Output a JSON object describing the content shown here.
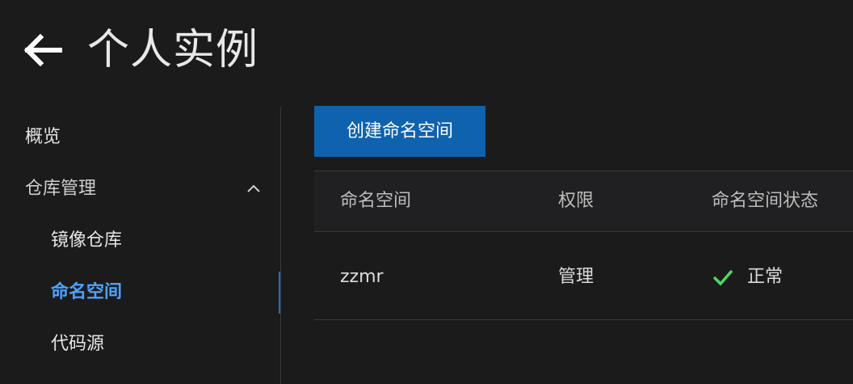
{
  "header": {
    "title": "个人实例",
    "back_icon": "arrow-left-icon"
  },
  "sidebar": {
    "items": [
      {
        "label": "概览"
      },
      {
        "label": "仓库管理",
        "expanded": true,
        "icon": "chevron-up-icon"
      },
      {
        "label": "镜像仓库"
      },
      {
        "label": "命名空间",
        "active": true
      },
      {
        "label": "代码源"
      }
    ]
  },
  "main": {
    "create_button_label": "创建命名空间",
    "table": {
      "columns": [
        "命名空间",
        "权限",
        "命名空间状态"
      ],
      "rows": [
        {
          "namespace": "zzmr",
          "permission": "管理",
          "status": "正常",
          "status_icon": "check-icon"
        }
      ]
    }
  },
  "colors": {
    "background": "#1b1b1c",
    "accent": "#0f62ad",
    "active_text": "#4ea3ff",
    "status_ok": "#4cd964"
  }
}
